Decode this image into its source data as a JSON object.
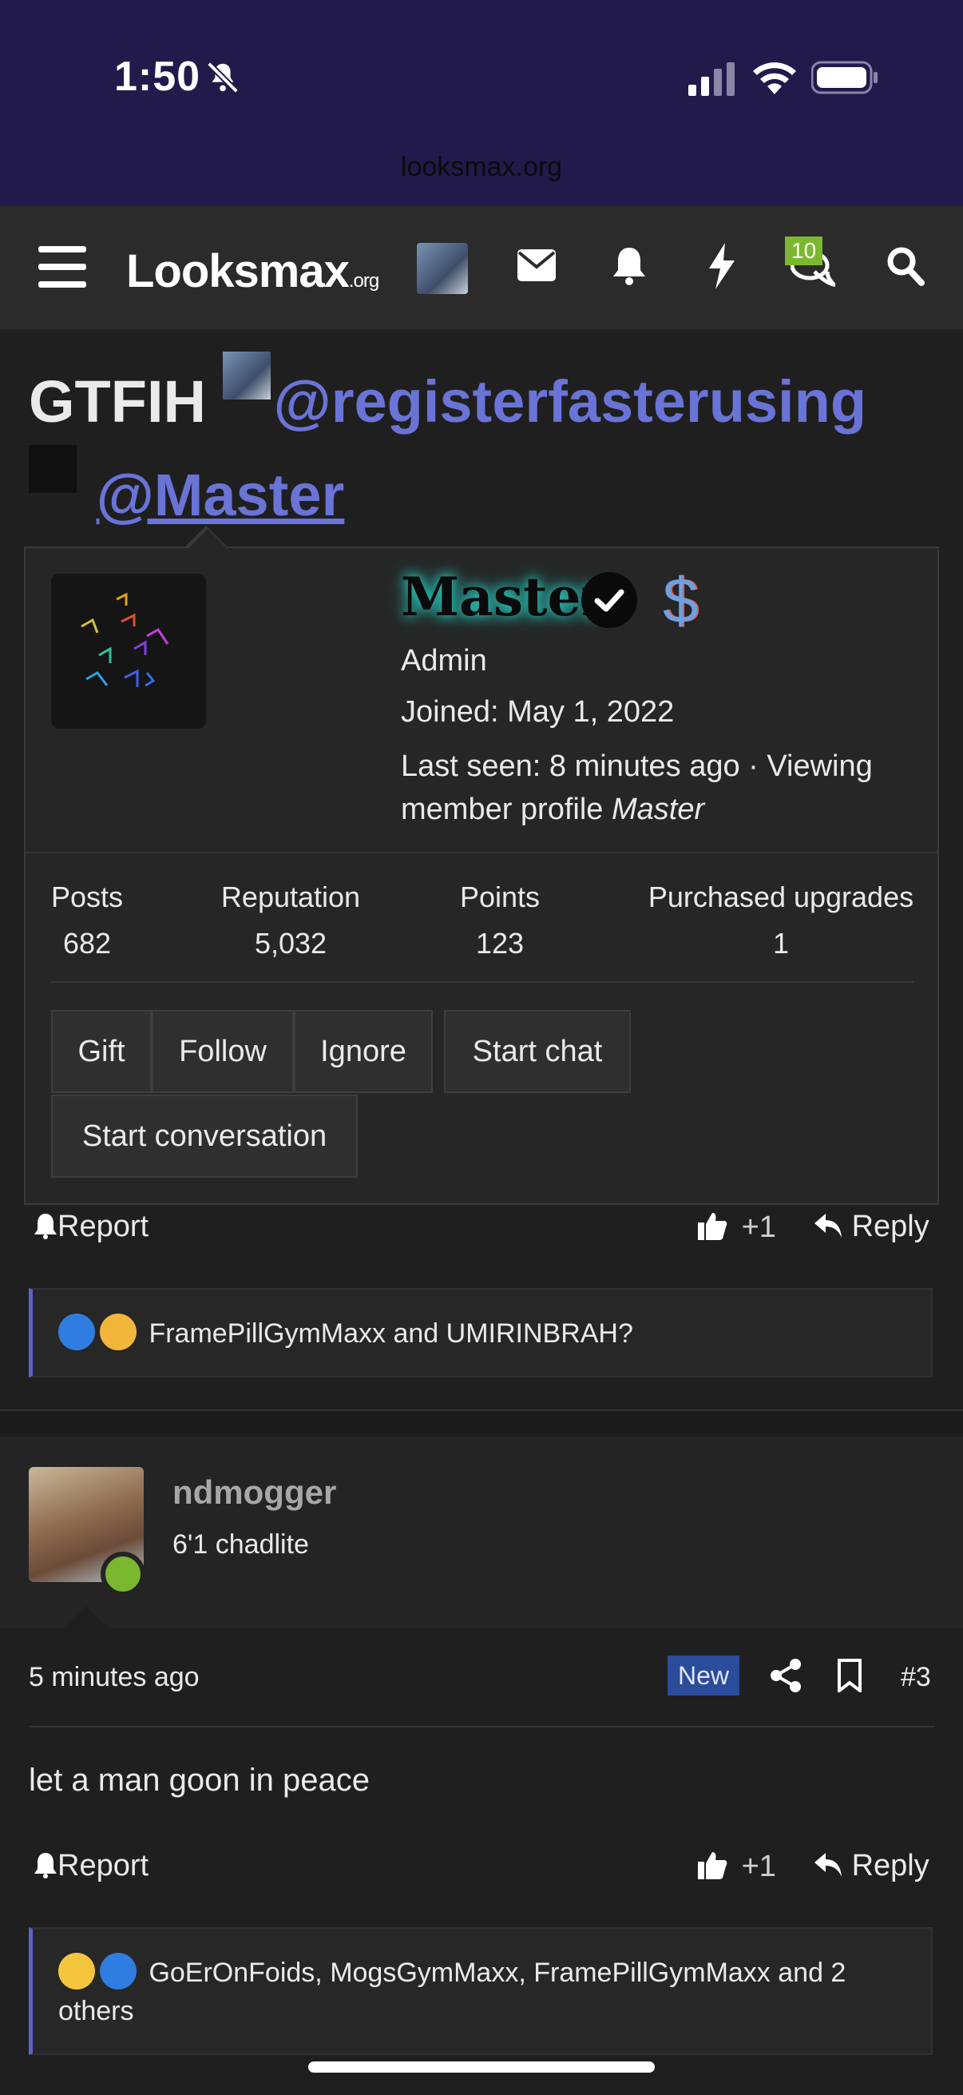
{
  "status_bar": {
    "time": "1:50",
    "url": "looksmax.org"
  },
  "nav": {
    "logo": "Looksmax",
    "logo_suffix": ".org",
    "chat_badge": "10"
  },
  "thread": {
    "title_prefix": "GTFIH",
    "mention1": "@registerfasterusing",
    "mention2": "@Master"
  },
  "member_card": {
    "name": "Master",
    "role": "Admin",
    "joined": "Joined: May 1, 2022",
    "last_seen": "Last seen: 8 minutes ago · Viewing member profile",
    "last_seen_italic": "Master",
    "stats": [
      {
        "label": "Posts",
        "value": "682"
      },
      {
        "label": "Reputation",
        "value": "5,032"
      },
      {
        "label": "Points",
        "value": "123"
      },
      {
        "label": "Purchased upgrades",
        "value": "1"
      }
    ],
    "buttons": [
      "Gift",
      "Follow",
      "Ignore",
      "Start chat",
      "Start conversation"
    ]
  },
  "post1": {
    "report": "Report",
    "like": "+1",
    "reply": "Reply",
    "reactions": "FramePillGymMaxx and UMIRINBRAH?"
  },
  "post2": {
    "username": "ndmogger",
    "user_title": "6'1 chadlite",
    "time_ago": "5 minutes ago",
    "new_badge": "New",
    "post_number": "#3",
    "body": "let a man goon in peace",
    "report": "Report",
    "like": "+1",
    "reply": "Reply",
    "reactions": "GoErOnFoids, MogsGymMaxx, FramePillGymMaxx and 2 others"
  },
  "colors": {
    "accent": "#6a73d6",
    "online": "#7cb82f",
    "new_badge": "#2b4b9b",
    "status_bar": "#221a4a"
  }
}
